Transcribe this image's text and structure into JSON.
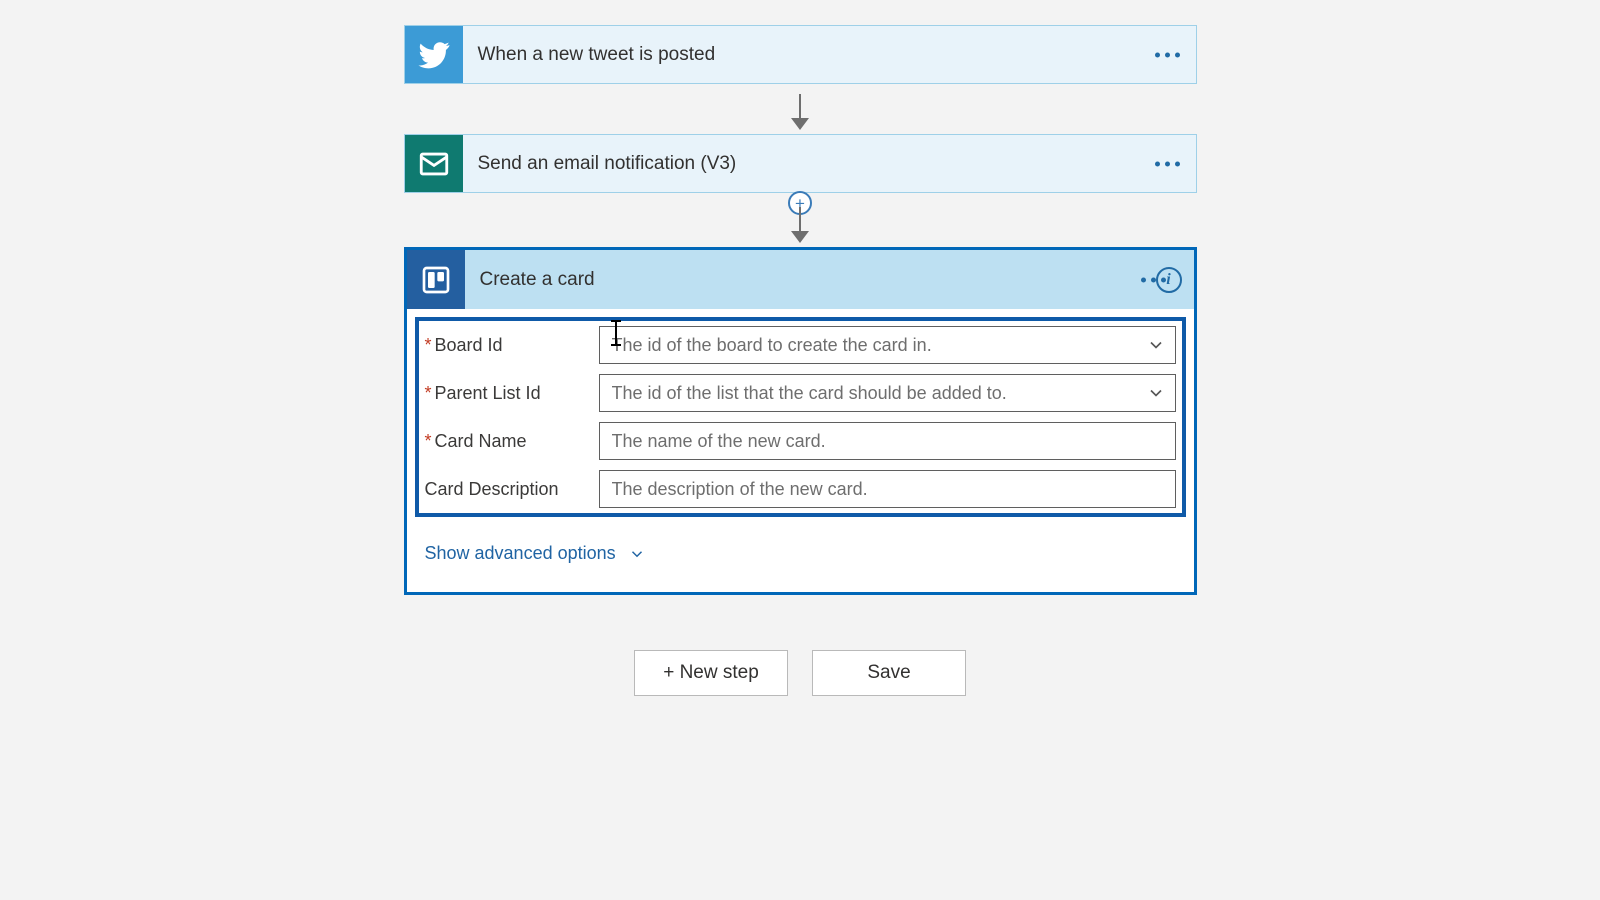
{
  "steps": {
    "twitter": {
      "title": "When a new tweet is posted"
    },
    "mail": {
      "title": "Send an email notification (V3)"
    },
    "trello": {
      "title": "Create a card"
    }
  },
  "fields": {
    "board_id": {
      "label": "Board Id",
      "placeholder": "The id of the board to create the card in."
    },
    "parent_list": {
      "label": "Parent List Id",
      "placeholder": "The id of the list that the card should be added to."
    },
    "card_name": {
      "label": "Card Name",
      "placeholder": "The name of the new card."
    },
    "card_desc": {
      "label": "Card Description",
      "placeholder": "The description of the new card."
    }
  },
  "advanced_label": "Show advanced options",
  "buttons": {
    "new_step": "+ New step",
    "save": "Save"
  }
}
